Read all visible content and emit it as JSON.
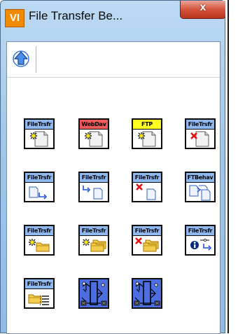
{
  "window": {
    "app_icon_text": "VI",
    "title": "File Transfer Be...",
    "close_glyph": "x"
  },
  "toolbar": {
    "up_button_icon": "up-arrow-icon"
  },
  "colors": {
    "header_blue": "#8fb8f0",
    "header_red": "#f05a5a",
    "header_yellow": "#ffff20",
    "express_blue": "#4d6ee0"
  },
  "palette": {
    "items": [
      {
        "label": "FileTrsfr",
        "icon": "new-file-icon",
        "header_color": "#8fb8f0"
      },
      {
        "label": "WebDav",
        "icon": "new-file-icon",
        "header_color": "#f05a5a"
      },
      {
        "label": "FTP",
        "icon": "new-file-icon",
        "header_color": "#ffff20"
      },
      {
        "label": "FileTrsfr",
        "icon": "delete-file-icon",
        "header_color": "#8fb8f0"
      },
      {
        "label": "FileTrsfr",
        "icon": "move-file-right-icon",
        "header_color": "#8fb8f0"
      },
      {
        "label": "FileTrsfr",
        "icon": "move-file-left-icon",
        "header_color": "#8fb8f0"
      },
      {
        "label": "FileTrsfr",
        "icon": "delete-file-small-icon",
        "header_color": "#8fb8f0"
      },
      {
        "label": "FTBehav",
        "icon": "copy-file-icon",
        "header_color": "#8fb8f0"
      },
      {
        "label": "FileTrsfr",
        "icon": "new-folder-icon",
        "header_color": "#8fb8f0"
      },
      {
        "label": "FileTrsfr",
        "icon": "new-folder-multi-icon",
        "header_color": "#8fb8f0"
      },
      {
        "label": "FileTrsfr",
        "icon": "delete-folder-icon",
        "header_color": "#8fb8f0"
      },
      {
        "label": "FileTrsfr",
        "icon": "info-connection-icon",
        "header_color": "#8fb8f0"
      },
      {
        "label": "FileTrsfr",
        "icon": "folder-list-icon",
        "header_color": "#8fb8f0"
      },
      {
        "label": "",
        "icon": "express-transfer-icon",
        "header_color": "#4d6ee0"
      },
      {
        "label": "",
        "icon": "express-transfer-icon",
        "header_color": "#4d6ee0"
      }
    ]
  }
}
